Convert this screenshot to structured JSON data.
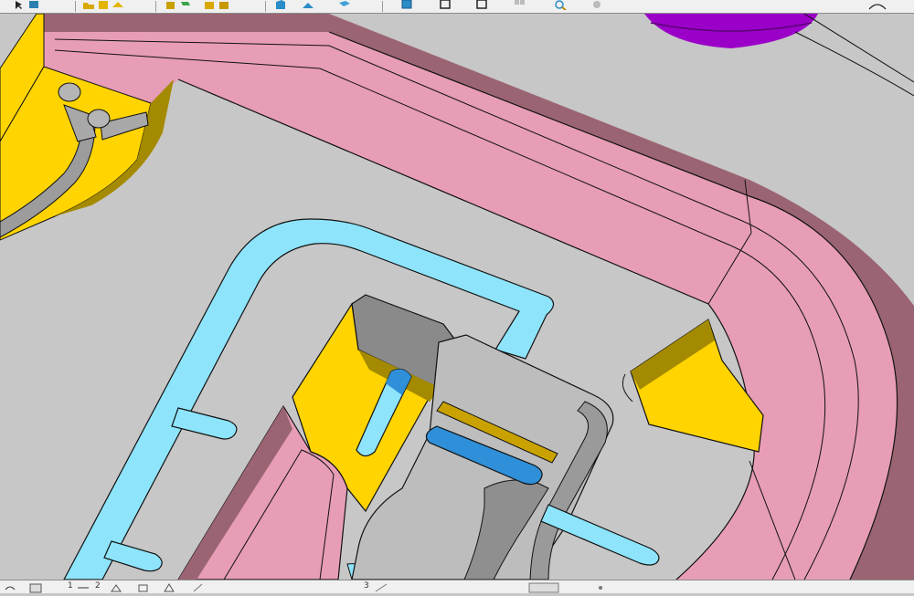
{
  "colors": {
    "background_face": "#c7c7c7",
    "pink_rib": "#e79db5",
    "pink_rib_shadow": "#9b6473",
    "yellow_face": "#ffd400",
    "yellow_shadow": "#a48a00",
    "blue_slot": "#8ee4fb",
    "blue_shadow": "#2f8fd8",
    "gray_pocket": "#8a8a8a",
    "purple_boss": "#9b00c8",
    "edge_line": "#111111",
    "toolbar_bg": "#f0f0f0"
  },
  "top_toolbar": {
    "icons": [
      "pointer-icon",
      "move-icon",
      "open-folder-icon",
      "save-icon",
      "layer-icon",
      "box-icon",
      "cube-front-icon",
      "cube-side-icon",
      "cube-iso-icon",
      "view-front-icon",
      "view-top-icon",
      "view-right-icon",
      "grid-icon",
      "zoom-icon",
      "rotate-icon",
      "measure-icon",
      "folder-icon",
      "folder-open-icon",
      "arc-icon"
    ]
  },
  "bottom_toolbar": {
    "labels": [
      "1",
      "2",
      "3"
    ],
    "icons": [
      "select-icon",
      "layer-1-icon",
      "layer-2-icon",
      "tilt-icon",
      "shape-icon",
      "pen-icon",
      "triangle-icon",
      "view-icon",
      "wire-icon",
      "point-icon"
    ]
  }
}
